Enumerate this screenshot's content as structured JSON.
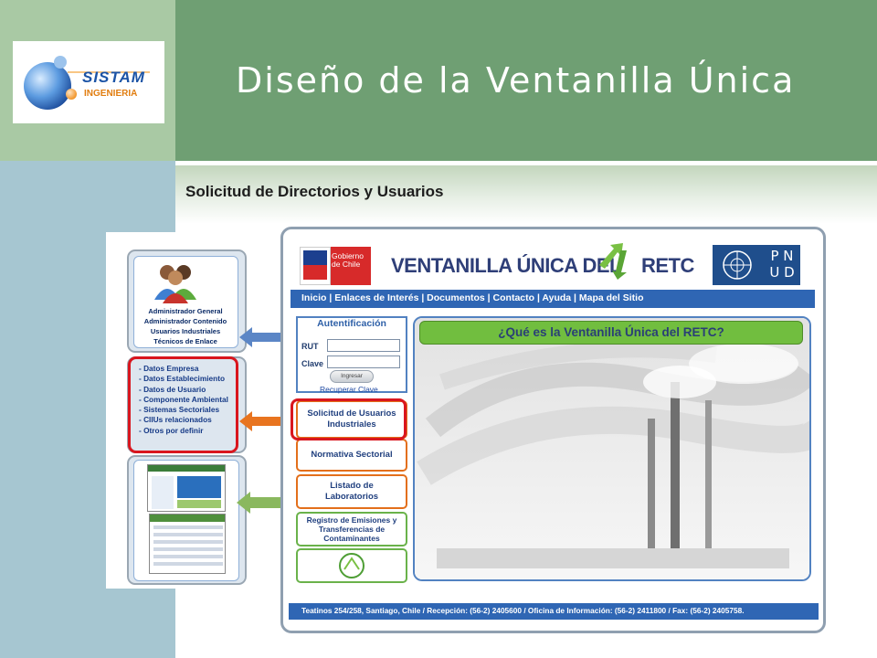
{
  "slide": {
    "title": "Diseño de la Ventanilla Única",
    "subtitle": "Solicitud de Directorios y Usuarios",
    "logo": {
      "line1": "SISTAM",
      "line2": "INGENIERIA"
    }
  },
  "left_panel": {
    "roles": [
      "Administrador General",
      "Administrador Contenido",
      "Usuarios Industriales",
      "Técnicos de Enlace"
    ],
    "fields": [
      "- Datos Empresa",
      "- Datos Establecimiento",
      "- Datos de Usuario",
      "- Componente Ambiental",
      "- Sistemas Sectoriales",
      "- CIIUs relacionados",
      "- Otros por definir"
    ],
    "arrow_colors": [
      "#5b86c6",
      "#e8741f",
      "#8ab85e"
    ]
  },
  "webpage": {
    "gov_text": [
      "Gobierno",
      "de Chile"
    ],
    "banner_title": {
      "part1": "VENTANILLA ÚNICA DEL",
      "part2": "RETC"
    },
    "pnud_letters": "P N U D",
    "nav": "Inicio | Enlaces de Interés | Documentos | Contacto | Ayuda | Mapa del Sitio",
    "auth": {
      "title": "Autentificación",
      "rut_label": "RUT",
      "clave_label": "Clave",
      "button": "Ingresar",
      "recover_link": "Recuperar Clave"
    },
    "side_buttons": [
      "Solicitud de Usuarios Industriales",
      "Normativa Sectorial",
      "Listado de Laboratorios",
      "Registro de Emisiones y Transferencias de Contaminantes"
    ],
    "main_question": "¿Qué es la Ventanilla Única del RETC?",
    "footer": "Teatinos 254/258, Santiago, Chile / Recepción: (56-2) 2405600 / Oficina de Información: (56-2) 2411800 / Fax: (56-2) 2405758."
  },
  "colors": {
    "title_band": "#6f9f73",
    "left_band_top": "#a9c9a4",
    "left_band_bottom": "#a6c6d1",
    "nav_blue": "#2f66b4",
    "highlight_red": "#d9161e",
    "retc_green": "#71be3f"
  }
}
